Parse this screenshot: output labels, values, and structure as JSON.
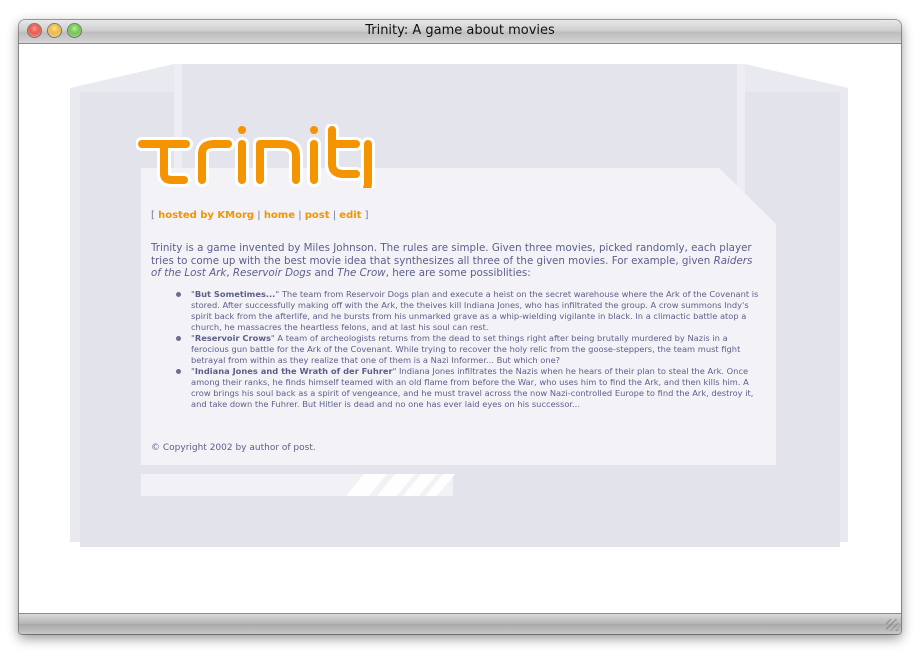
{
  "window": {
    "title": "Trinity: A game about movies"
  },
  "logo": {
    "text": "Trinity",
    "color": "#F39400"
  },
  "nav": {
    "open": "[",
    "items": [
      {
        "label": "hosted by KMorg"
      },
      {
        "label": "home"
      },
      {
        "label": "post"
      },
      {
        "label": "edit"
      }
    ],
    "separator": "|",
    "close": "]"
  },
  "intro": {
    "text": "Trinity is a game invented by Miles Johnson. The rules are simple. Given three movies, picked randomly, each player tries to come up with the best movie idea that synthesizes all three of the given movies. For example, given",
    "movie1": "Raiders of the Lost Ark",
    "sep1": ",",
    "movie2": "Reservoir Dogs",
    "and": "and",
    "movie3": "The Crow",
    "tail": ", here are some possiblities:"
  },
  "ideas": [
    {
      "title": "But Sometimes...",
      "text": "The team from Reservoir Dogs plan and execute a heist on the secret warehouse where the Ark of the Covenant is stored. After successfully making off with the Ark, the theives kill Indiana Jones, who has infiltrated the group. A crow summons Indy's spirit back from the afterlife, and he bursts from his unmarked grave as a whip-wielding vigilante in black. In a climactic battle atop a church, he massacres the heartless felons, and at last his soul can rest."
    },
    {
      "title": "Reservoir Crows",
      "text": "A team of archeologists returns from the dead to set things right after being brutally murdered by Nazis in a ferocious gun battle for the Ark of the Covenant. While trying to recover the holy relic from the goose-steppers, the team must fight betrayal from within as they realize that one of them is a Nazi Informer... But which one?"
    },
    {
      "title": "Indiana Jones and the Wrath of der Fuhrer",
      "text": "Indiana Jones infiltrates the Nazis when he hears of their plan to steal the Ark. Once among their ranks, he finds himself teamed with an old flame from before the War, who uses him to find the Ark, and then kills him. A crow brings his soul back as a spirit of vengeance, and he must travel across the now Nazi-controlled Europe to find the Ark, destroy it, and take down the Fuhrer. But Hitler is dead and no one has ever laid eyes on his successor..."
    }
  ],
  "footer": {
    "text": "© Copyright 2002 by author of post."
  }
}
